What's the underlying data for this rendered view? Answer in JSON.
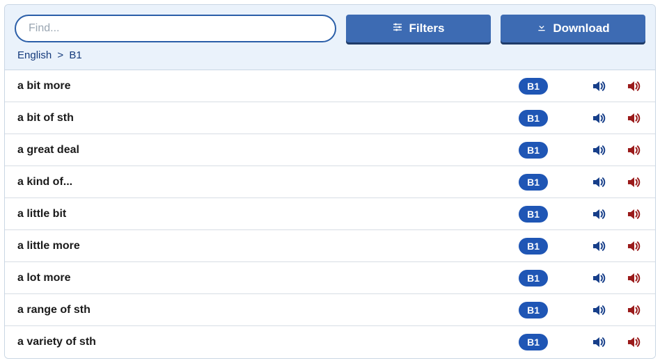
{
  "toolbar": {
    "search_placeholder": "Find...",
    "filters_label": "Filters",
    "download_label": "Download"
  },
  "breadcrumb": {
    "items": [
      "English",
      "B1"
    ]
  },
  "list": {
    "items": [
      {
        "term": "a bit more",
        "level": "B1"
      },
      {
        "term": "a bit of sth",
        "level": "B1"
      },
      {
        "term": "a great deal",
        "level": "B1"
      },
      {
        "term": "a kind of...",
        "level": "B1"
      },
      {
        "term": "a little bit",
        "level": "B1"
      },
      {
        "term": "a little more",
        "level": "B1"
      },
      {
        "term": "a lot more",
        "level": "B1"
      },
      {
        "term": "a range of sth",
        "level": "B1"
      },
      {
        "term": "a variety of sth",
        "level": "B1"
      }
    ]
  },
  "icons": {
    "audio_primary": "speaker-icon",
    "audio_secondary": "speaker-icon"
  }
}
